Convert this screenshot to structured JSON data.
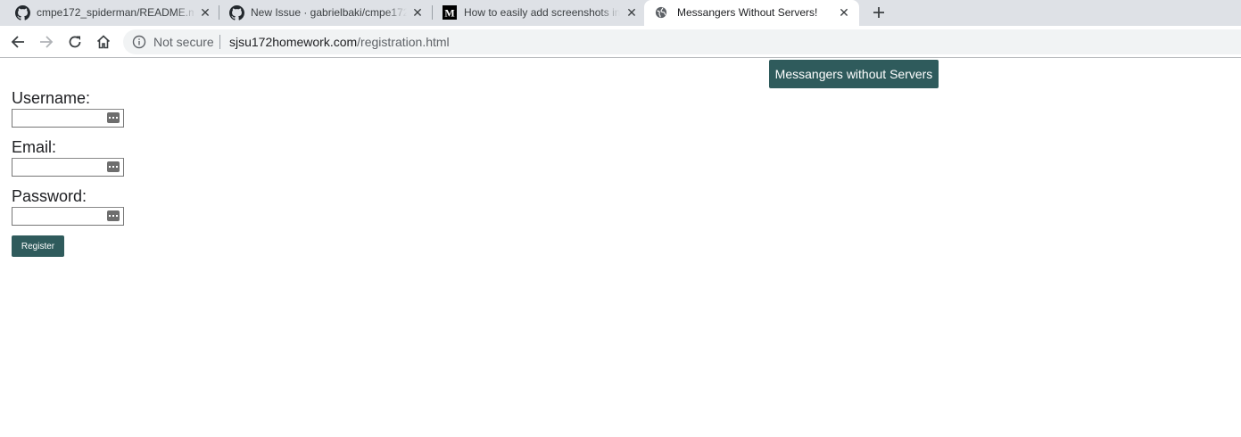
{
  "browser": {
    "tabs": [
      {
        "title": "cmpe172_spiderman/README.m",
        "favicon": "github-icon"
      },
      {
        "title": "New Issue · gabrielbaki/cmpe172",
        "favicon": "github-icon"
      },
      {
        "title": "How to easily add screenshots in",
        "favicon": "medium-icon"
      },
      {
        "title": "Messangers Without Servers!",
        "favicon": "globe-icon",
        "active": true
      }
    ],
    "address": {
      "security": "Not secure",
      "host": "sjsu172homework.com",
      "path": "/registration.html"
    }
  },
  "page": {
    "header_button": "Messangers without Servers",
    "form": {
      "username_label": "Username:",
      "username_value": "",
      "email_label": "Email:",
      "email_value": "",
      "password_label": "Password:",
      "password_value": "",
      "submit_label": "Register"
    }
  },
  "colors": {
    "accent": "#2f5b5c",
    "tabstrip": "#dee1e6",
    "omnibox": "#f1f3f4"
  }
}
